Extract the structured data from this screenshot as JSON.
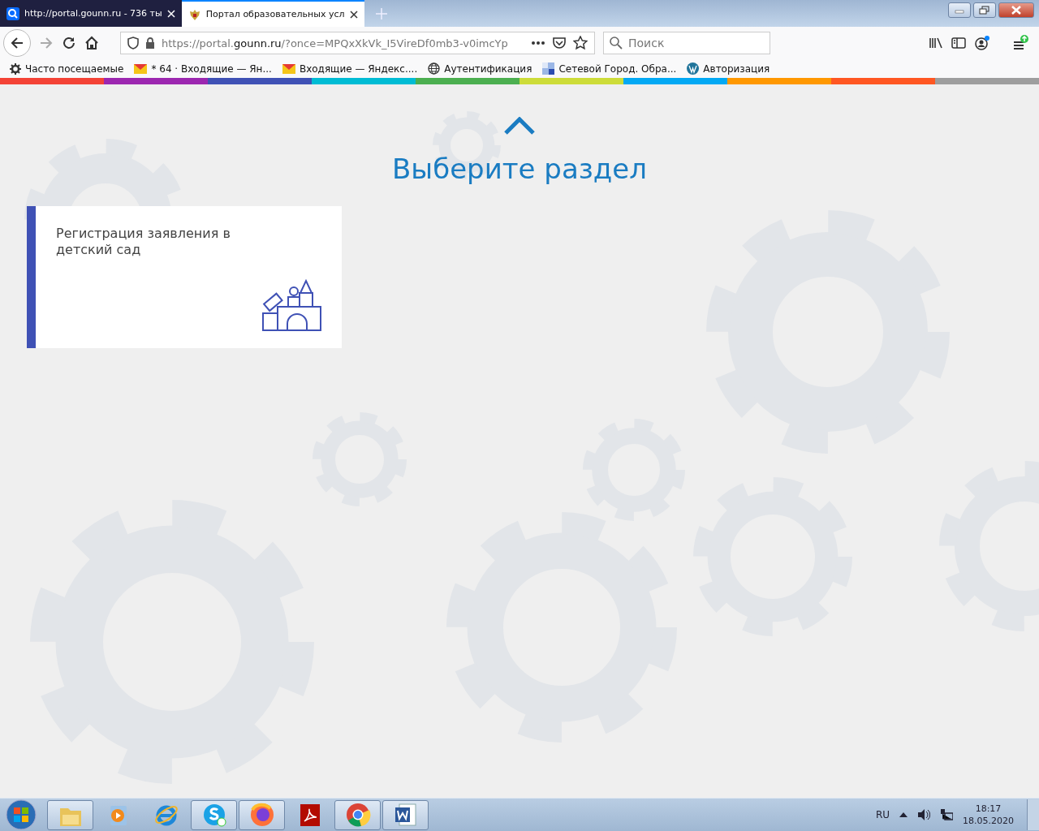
{
  "tabs": [
    {
      "title": "http://portal.gounn.ru - 736 ты",
      "kind": "search",
      "selected": false
    },
    {
      "title": "Портал образовательных усл",
      "kind": "emblem",
      "selected": true
    }
  ],
  "address": {
    "scheme": "https://portal.",
    "host": "gounn.ru",
    "rest": "/?once=MPQxXkVk_I5VireDf0mb3-v0imcYp"
  },
  "search": {
    "placeholder": "Поиск"
  },
  "bookmarks": [
    {
      "label": "Часто посещаемые",
      "kind": "gear"
    },
    {
      "label": "* 64 · Входящие — Ян...",
      "kind": "mail"
    },
    {
      "label": "Входящие — Яндекс....",
      "kind": "mail"
    },
    {
      "label": "Аутентификация",
      "kind": "globe"
    },
    {
      "label": "Сетевой Город. Обра...",
      "kind": "tiles"
    },
    {
      "label": "Авторизация",
      "kind": "wp"
    }
  ],
  "stripe": [
    {
      "color": "#f44336"
    },
    {
      "color": "#9c27b0"
    },
    {
      "color": "#3f51b5"
    },
    {
      "color": "#00bcd4"
    },
    {
      "color": "#4caf50"
    },
    {
      "color": "#cddc39"
    },
    {
      "color": "#03a9f4"
    },
    {
      "color": "#ff9800"
    },
    {
      "color": "#ff5722"
    },
    {
      "color": "#9e9e9e"
    }
  ],
  "page": {
    "heading": "Выберите раздел",
    "cards": [
      {
        "title": "Регистрация заявления в детский сад"
      }
    ]
  },
  "taskbar": {
    "apps": [
      {
        "kind": "folder",
        "running": true
      },
      {
        "kind": "media",
        "running": false
      },
      {
        "kind": "ie",
        "running": false
      },
      {
        "kind": "skype",
        "running": true
      },
      {
        "kind": "firefox",
        "running": true
      },
      {
        "kind": "pdf",
        "running": false
      },
      {
        "kind": "chrome",
        "running": true
      },
      {
        "kind": "word",
        "running": true
      }
    ],
    "language": "RU",
    "time": "18:17",
    "date": "18.05.2020"
  }
}
